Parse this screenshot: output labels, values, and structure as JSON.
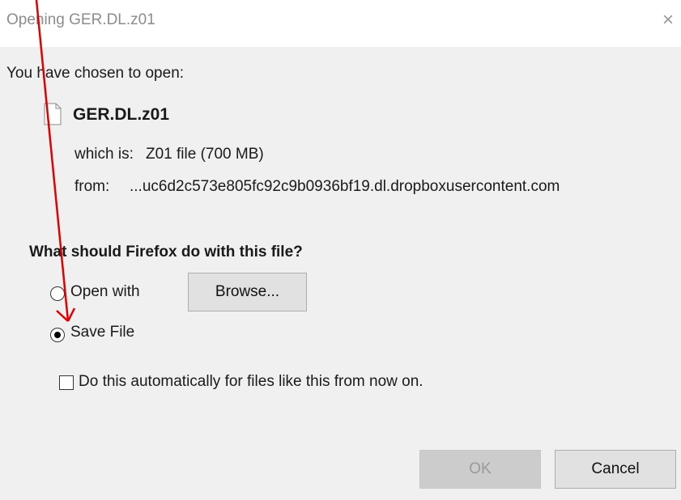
{
  "dialog": {
    "title": "Opening GER.DL.z01",
    "close_glyph": "×"
  },
  "intro": "You have chosen to open:",
  "file": {
    "name": "GER.DL.z01",
    "type_label": "which is:",
    "type_value": "Z01 file (700 MB)",
    "from_label": "from:",
    "from_value": "...uc6d2c573e805fc92c9b0936bf19.dl.dropboxusercontent.com",
    "icon": "file-icon"
  },
  "question": "What should Firefox do with this file?",
  "options": {
    "open_with": {
      "label": "Open with",
      "selected": false
    },
    "browse_label": "Browse...",
    "save_file": {
      "label": "Save File",
      "selected": true
    },
    "auto_label": "Do this automatically for files like this from now on.",
    "auto_checked": false
  },
  "buttons": {
    "ok": "OK",
    "cancel": "Cancel"
  },
  "annotation": {
    "arrow_color": "#e00000"
  }
}
